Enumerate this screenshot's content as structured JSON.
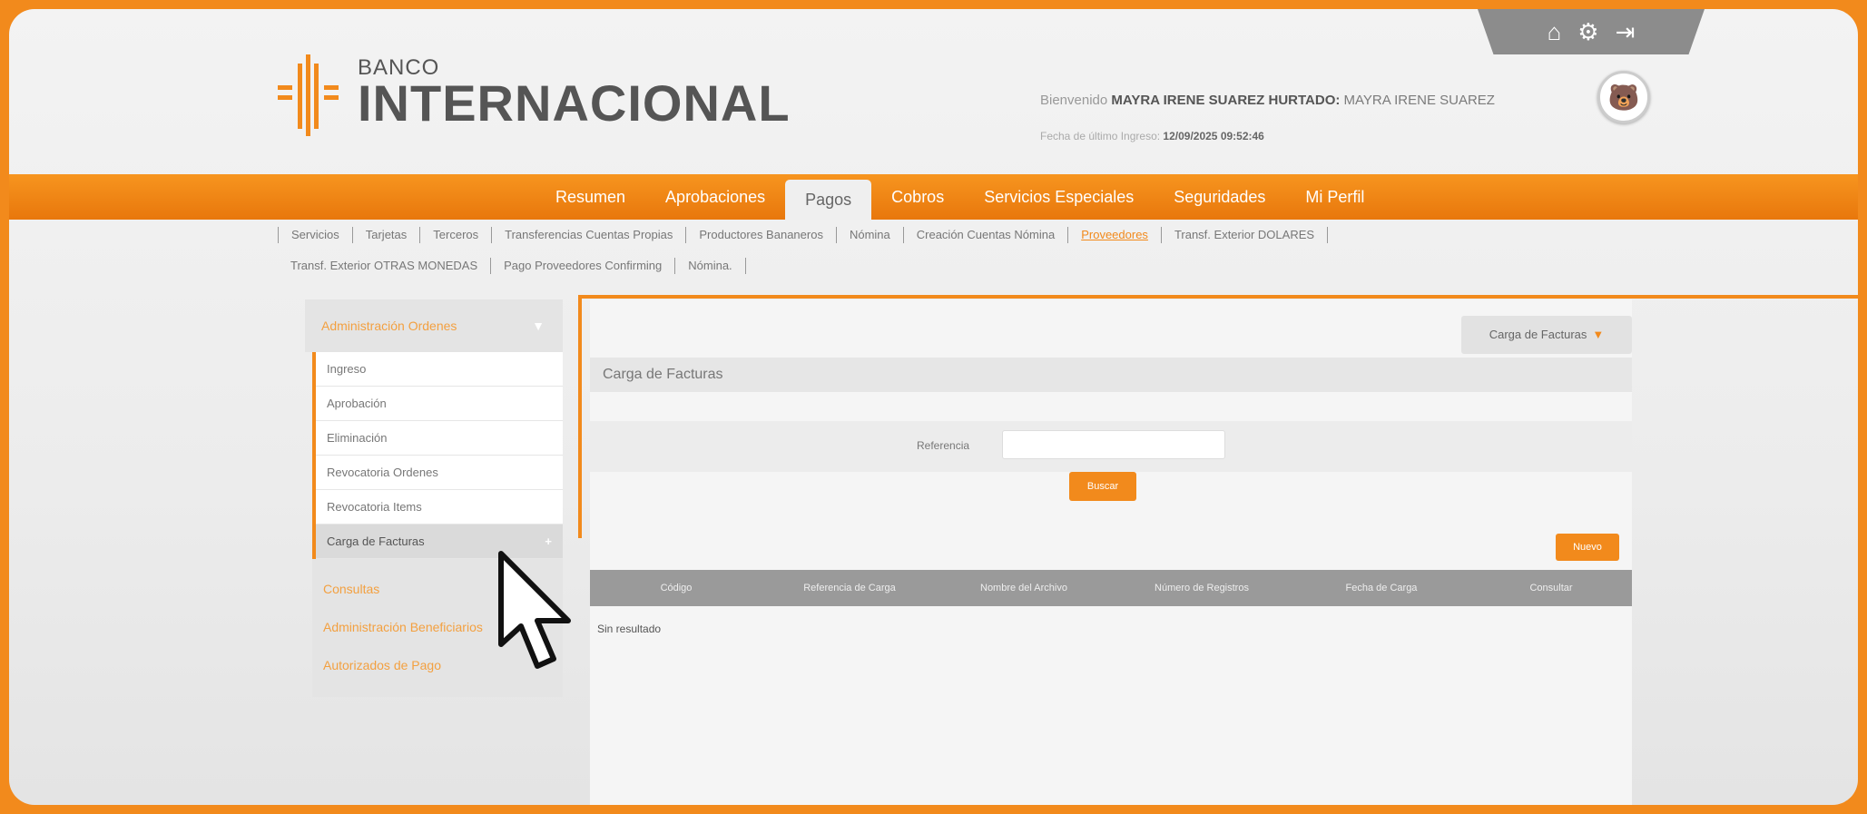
{
  "bank": {
    "small": "BANCO",
    "name": "INTERNACIONAL"
  },
  "user": {
    "welcome_prefix": "Bienvenido",
    "name": "MAYRA IRENE SUAREZ HURTADO:",
    "short_name": "MAYRA IRENE SUAREZ",
    "last_login_label": "Fecha de último Ingreso:",
    "last_login": "12/09/2025 09:52:46"
  },
  "top_icons": [
    "home-icon",
    "settings-user-icon",
    "logout-icon"
  ],
  "main_nav": {
    "items": [
      "Resumen",
      "Aprobaciones",
      "Pagos",
      "Cobros",
      "Servicios Especiales",
      "Seguridades",
      "Mi Perfil"
    ],
    "active": "Pagos"
  },
  "sub_nav": {
    "row1": [
      "Servicios",
      "Tarjetas",
      "Terceros",
      "Transferencias Cuentas Propias",
      "Productores Bananeros",
      "Nómina",
      "Creación Cuentas Nómina",
      "Proveedores",
      "Transf. Exterior DOLARES"
    ],
    "row2": [
      "Transf. Exterior OTRAS MONEDAS",
      "Pago Proveedores Confirming",
      "Nómina."
    ],
    "active": "Proveedores"
  },
  "sidebar": {
    "header": "Administración Ordenes",
    "items": [
      "Ingreso",
      "Aprobación",
      "Eliminación",
      "Revocatoria Ordenes",
      "Revocatoria Items",
      "Carga de Facturas"
    ],
    "active": "Carga de Facturas",
    "groups": [
      "Consultas",
      "Administración Beneficiarios",
      "Autorizados de Pago"
    ]
  },
  "content": {
    "dropdown": "Carga de Facturas",
    "title": "Carga de Facturas",
    "reference_label": "Referencia",
    "reference_value": "",
    "search_button": "Buscar",
    "new_button": "Nuevo",
    "columns": [
      "Código",
      "Referencia de Carga",
      "Nombre del Archivo",
      "Número de Registros",
      "Fecha de Carga",
      "Consultar"
    ],
    "empty_text": "Sin resultado"
  },
  "colors": {
    "accent": "#f28a1c",
    "frame": "#f28a1c",
    "table_header": "#9a9a9a"
  }
}
